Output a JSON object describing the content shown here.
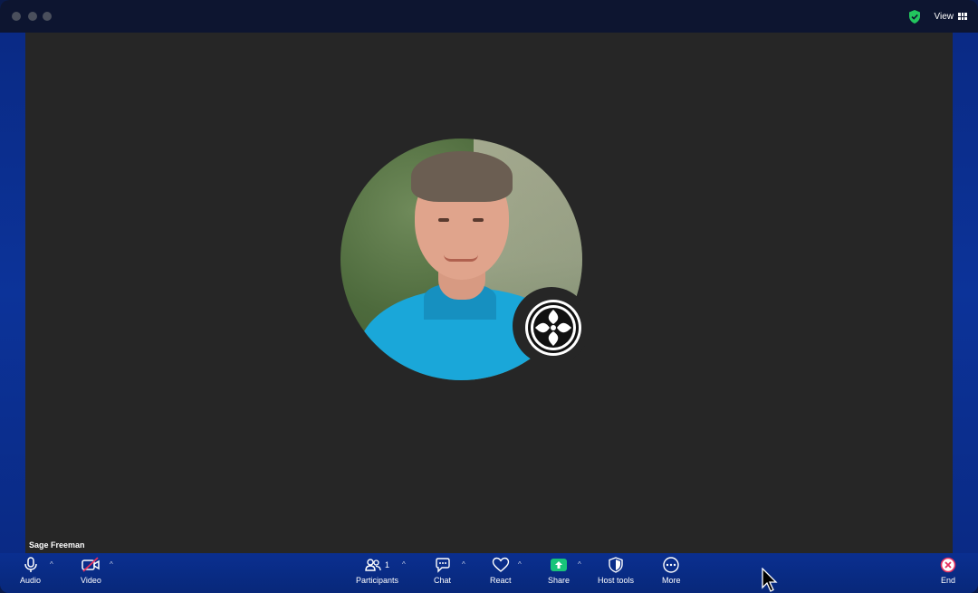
{
  "window": {
    "view_label": "View"
  },
  "participant": {
    "name": "Sage Freeman"
  },
  "toolbar": {
    "audio": "Audio",
    "video": "Video",
    "participants": "Participants",
    "participants_count": "1",
    "chat": "Chat",
    "react": "React",
    "share": "Share",
    "host_tools": "Host tools",
    "more": "More",
    "end": "End"
  },
  "colors": {
    "accent": "#0b2f8f",
    "share_green": "#18c47a",
    "video_off_red": "#e6305e",
    "end_red": "#e6305e",
    "shield_green": "#22c55e"
  }
}
